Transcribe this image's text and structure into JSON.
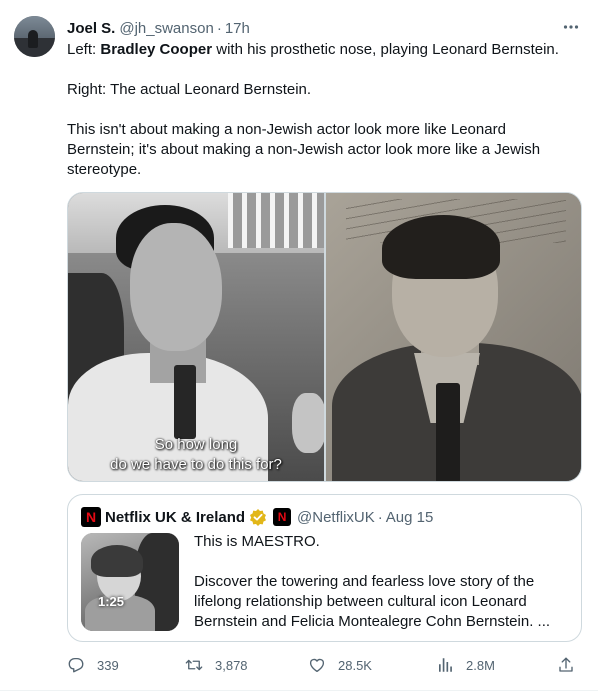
{
  "author": {
    "name": "Joel S.",
    "handle": "@jh_swanson",
    "separator": "·",
    "time": "17h"
  },
  "tweet": {
    "line1_prefix": "Left: ",
    "line1_bold": "Bradley Cooper",
    "line1_suffix": " with his prosthetic nose, playing Leonard Bernstein.",
    "line2": "Right: The actual Leonard Bernstein.",
    "line3a": "This isn't about making a non-Jewish actor look more like Leonard",
    "line3b": "Bernstein; it's about making a non-Jewish actor look more like a Jewish",
    "line3c": "stereotype."
  },
  "media": {
    "caption_line1": "So how long",
    "caption_line2": "do we have to do this for?"
  },
  "quote": {
    "logo_letter": "N",
    "name": "Netflix UK & Ireland",
    "handle": "@NetflixUK",
    "separator": "·",
    "date": "Aug 15",
    "video_duration": "1:25",
    "text_line1": "This is MAESTRO.",
    "text_line2": "Discover the towering and fearless love story of the",
    "text_line3": "lifelong relationship between cultural icon Leonard",
    "text_line4": "Bernstein and Felicia Montealegre Cohn Bernstein. ..."
  },
  "actions": {
    "replies": "339",
    "retweets": "3,878",
    "likes": "28.5K",
    "views": "2.8M"
  },
  "icons": {
    "more": "more-icon",
    "reply": "reply-icon",
    "retweet": "retweet-icon",
    "like": "heart-icon",
    "views": "views-icon",
    "share": "share-icon",
    "verified": "gold-verified-badge-icon"
  },
  "colors": {
    "text": "#0f1419",
    "secondary": "#536471",
    "border": "#cfd9de",
    "netflix_red": "#e50914",
    "verified_gold": "#e2b719"
  }
}
